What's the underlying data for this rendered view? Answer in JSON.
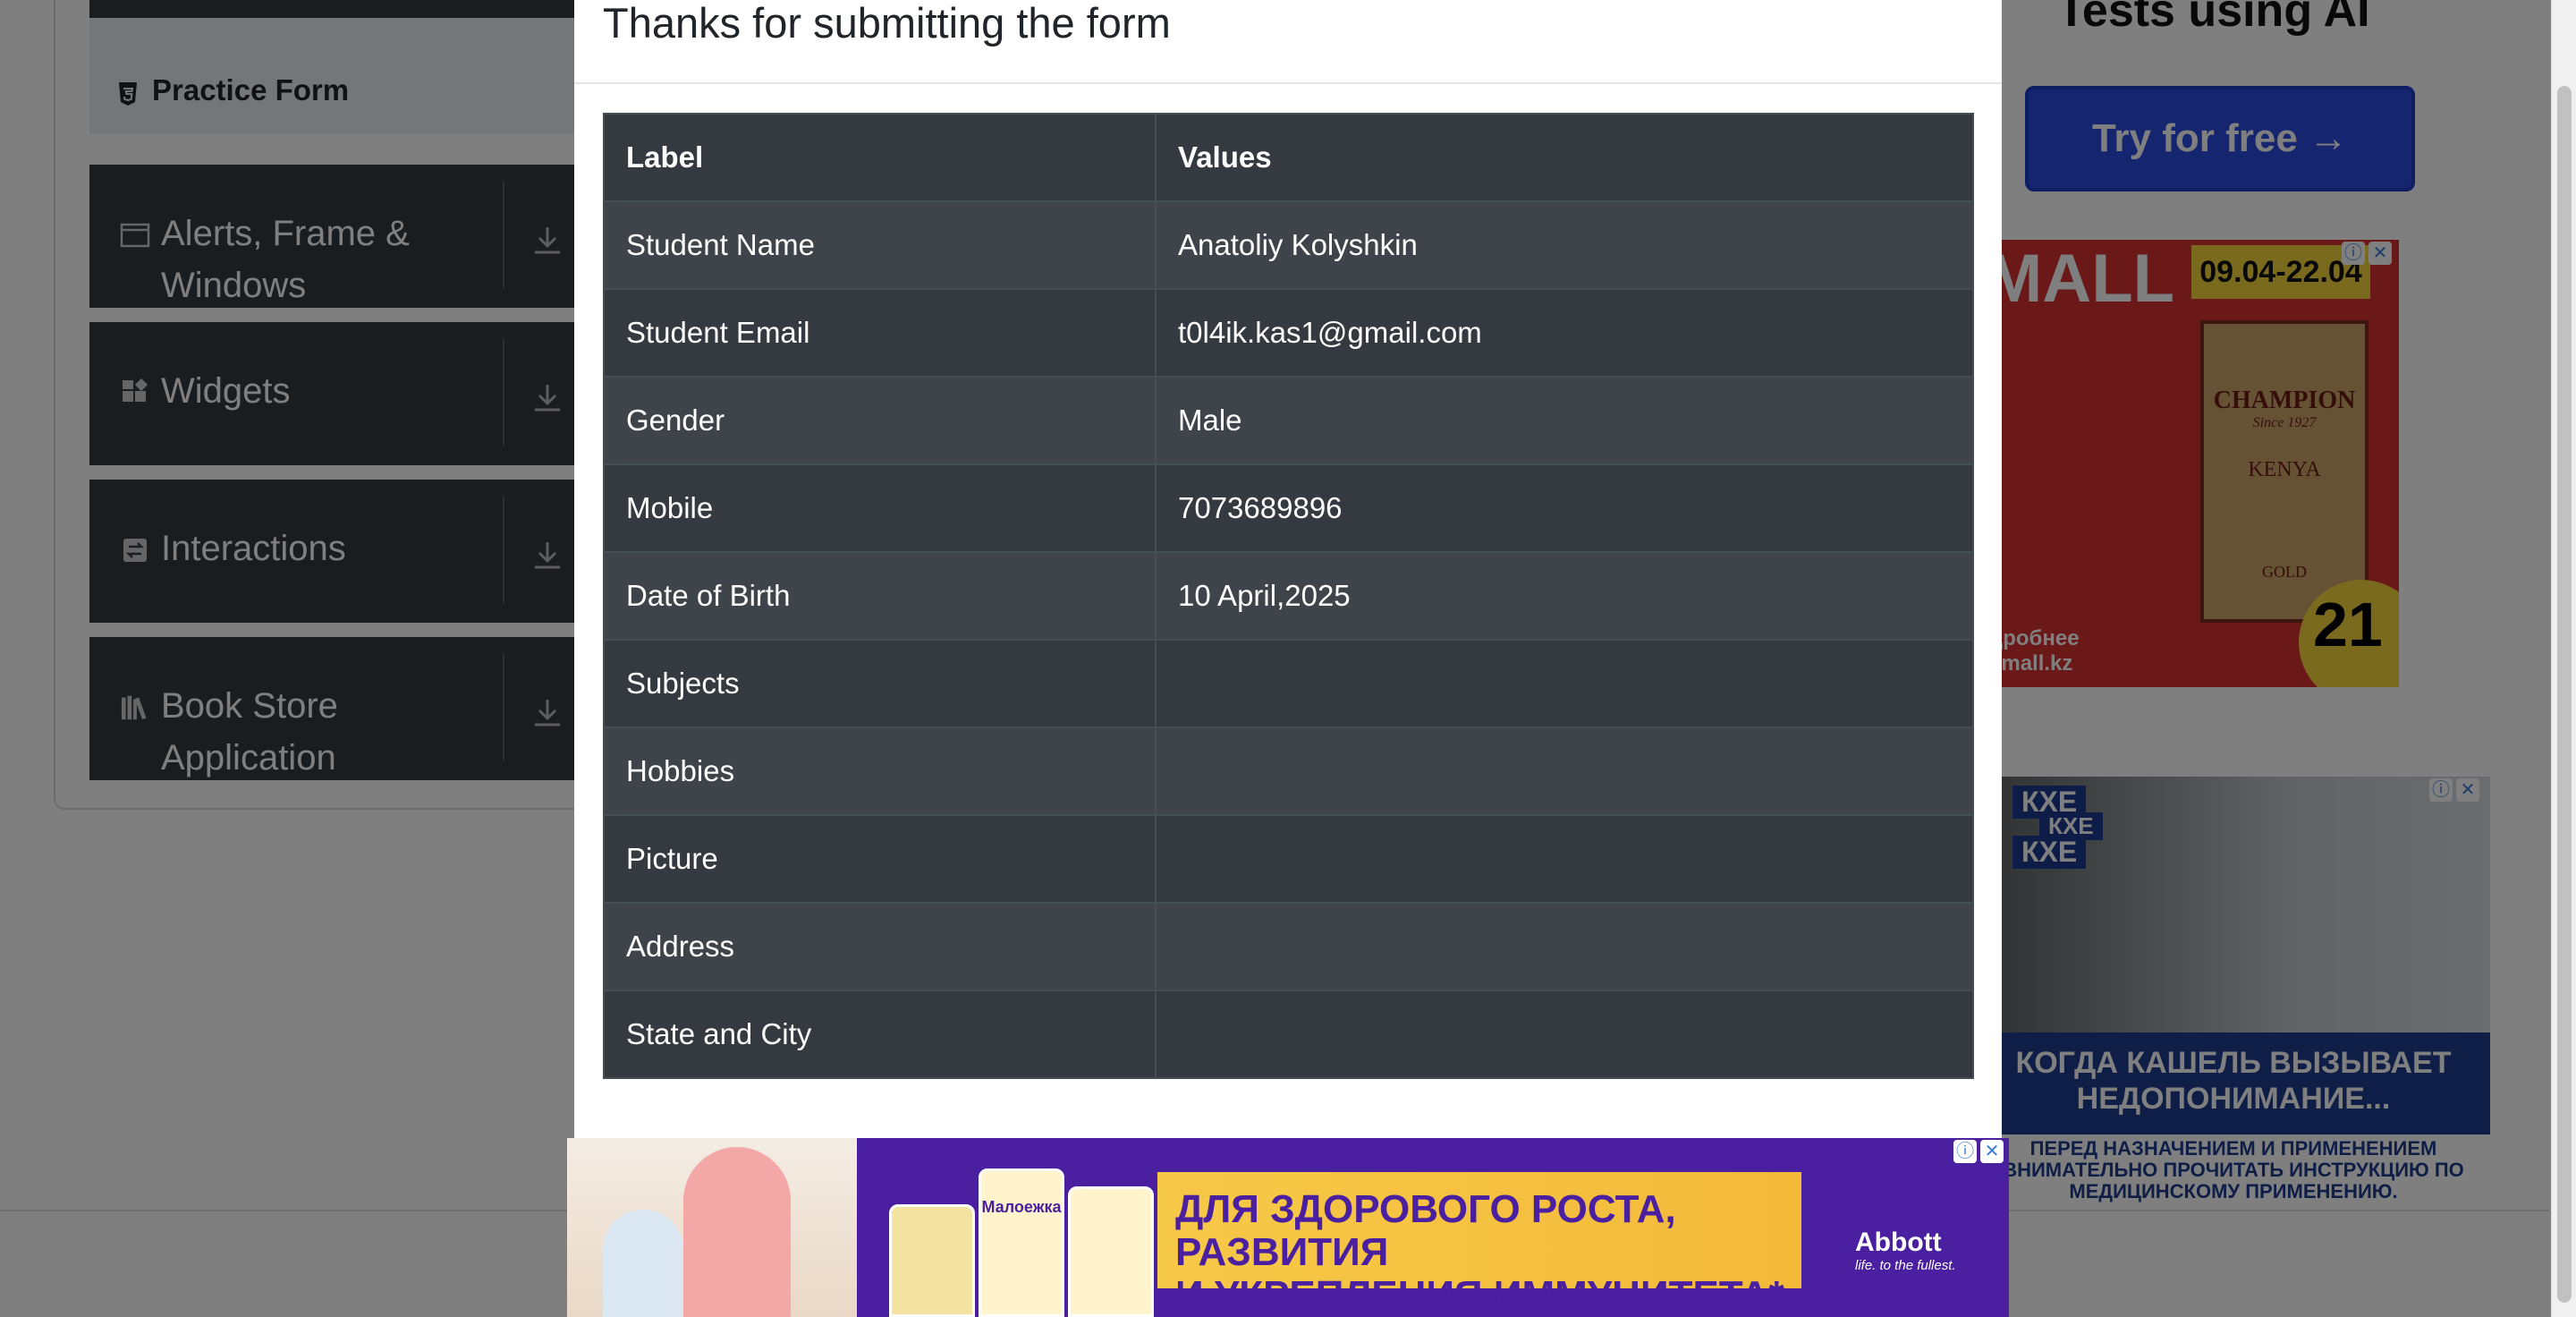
{
  "sidebar": {
    "practice_form_label": "Practice Form",
    "groups": [
      {
        "label": "Alerts, Frame & Windows",
        "icon": "window-icon"
      },
      {
        "label": "Widgets",
        "icon": "widgets-icon"
      },
      {
        "label": "Interactions",
        "icon": "interactions-icon"
      },
      {
        "label": "Book Store Application",
        "icon": "books-icon"
      }
    ]
  },
  "modal": {
    "title": "Thanks for submitting the form",
    "headers": [
      "Label",
      "Values"
    ],
    "rows": [
      [
        "Student Name",
        "Anatoliy Kolyshkin"
      ],
      [
        "Student Email",
        "t0l4ik.kas1@gmail.com"
      ],
      [
        "Gender",
        "Male"
      ],
      [
        "Mobile",
        "7073689896"
      ],
      [
        "Date of Birth",
        "10 April,2025"
      ],
      [
        "Subjects",
        ""
      ],
      [
        "Hobbies",
        ""
      ],
      [
        "Picture",
        ""
      ],
      [
        "Address",
        ""
      ],
      [
        "State and City",
        ""
      ]
    ]
  },
  "ads": {
    "right_top_heading": "Tests using AI",
    "right_top_button": "Try for free →",
    "mall_title": "MALL",
    "mall_dates": "09.04-22.04",
    "mall_pack_brand": "CHAMPION",
    "mall_pack_since": "Since 1927",
    "mall_pack_origin": "KENYA",
    "mall_pack_sub": "GOLD",
    "mall_price": "21",
    "mall_footer_1": "дробнее",
    "mall_footer_2": "small.kz",
    "cough_tag": "КХЕ",
    "cough_headline": "КОГДА КАШЕЛЬ ВЫЗЫВАЕТ НЕДОПОНИМАНИЕ...",
    "cough_disclaimer": "ПЕРЕД НАЗНАЧЕНИЕМ И ПРИМЕНЕНИЕМ ВНИМАТЕЛЬНО ПРОЧИТАТЬ ИНСТРУКЦИЮ ПО МЕДИЦИНСКОМУ ПРИМЕНЕНИЮ.",
    "bottom_product": "Малоежка",
    "bottom_text_1": "ДЛЯ ЗДОРОВОГО РОСТА, РАЗВИТИЯ",
    "bottom_text_2": "И УКРЕПЛЕНИЯ ИММУНИТЕТА*",
    "bottom_brand": "Abbott",
    "bottom_slogan": "life. to the fullest.",
    "info_glyph": "ⓘ",
    "close_glyph": "✕"
  },
  "colors": {
    "sidebar_group_bg": "#343a40",
    "table_bg": "#343a40",
    "overlay": "rgba(0,0,0,0.5)",
    "ad_button": "#2b4be0"
  }
}
